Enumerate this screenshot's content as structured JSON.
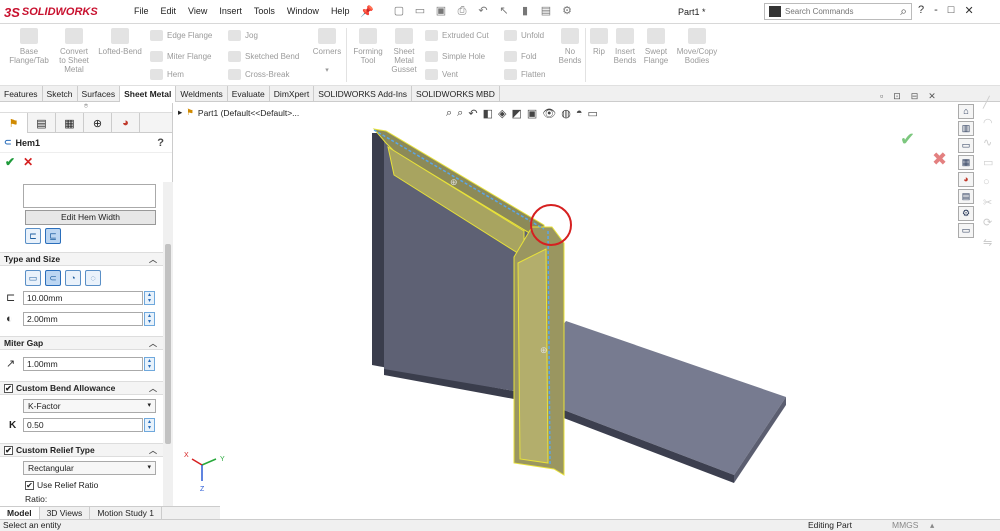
{
  "app": {
    "logo_text": "SOLIDWORKS",
    "doc_title": "Part1 *"
  },
  "menu": [
    "File",
    "Edit",
    "View",
    "Insert",
    "Tools",
    "Window",
    "Help"
  ],
  "search": {
    "placeholder": "Search Commands"
  },
  "window_controls": [
    "?",
    "-",
    "□",
    "✕"
  ],
  "ribbon": {
    "big": [
      {
        "label": "Base\nFlange/Tab"
      },
      {
        "label": "Convert\nto Sheet\nMetal"
      },
      {
        "label": "Lofted-Bend"
      },
      {
        "label": "Corners"
      },
      {
        "label": "Forming\nTool"
      },
      {
        "label": "Sheet\nMetal\nGusset"
      },
      {
        "label": "No\nBends"
      },
      {
        "label": "Rip"
      },
      {
        "label": "Insert\nBends"
      },
      {
        "label": "Swept\nFlange"
      },
      {
        "label": "Move/Copy\nBodies"
      }
    ],
    "small": [
      "Edge Flange",
      "Miter Flange",
      "Hem",
      "Jog",
      "Sketched Bend",
      "Cross-Break",
      "Extruded Cut",
      "Simple Hole",
      "Vent",
      "Unfold",
      "Fold",
      "Flatten"
    ]
  },
  "tabs": [
    "Features",
    "Sketch",
    "Surfaces",
    "Sheet Metal",
    "Weldments",
    "Evaluate",
    "DimXpert",
    "SOLIDWORKS Add-Ins",
    "SOLIDWORKS MBD"
  ],
  "active_tab": "Sheet Metal",
  "property_manager": {
    "title": "Hem1",
    "edit_hem_width": "Edit Hem Width",
    "type_and_size": {
      "header": "Type and Size",
      "length": "10.00mm",
      "gap": "2.00mm"
    },
    "miter_gap": {
      "header": "Miter Gap",
      "value": "1.00mm"
    },
    "custom_bend_allowance": {
      "header": "Custom Bend Allowance",
      "type": "K-Factor",
      "k_label": "K",
      "k_value": "0.50"
    },
    "custom_relief": {
      "header": "Custom Relief Type",
      "type": "Rectangular",
      "use_ratio": "Use Relief Ratio",
      "ratio_label": "Ratio:"
    }
  },
  "tree": {
    "item": "Part1  (Default<<Default>..."
  },
  "bottom_tabs": [
    "Model",
    "3D Views",
    "Motion Study 1"
  ],
  "status": {
    "left": "Select an entity",
    "editing": "Editing Part",
    "units": "MMGS"
  }
}
